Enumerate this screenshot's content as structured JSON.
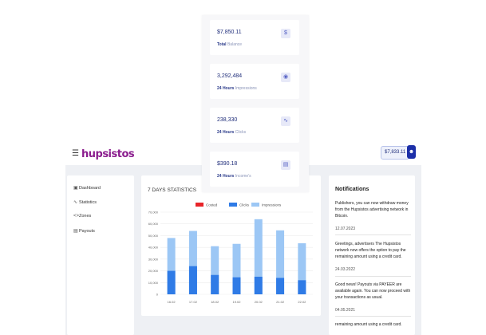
{
  "header": {
    "logo": "hupsistos",
    "balance": "$7,833.11"
  },
  "sidebar": {
    "items": [
      {
        "label": "Dashboard",
        "icon": "dashboard-icon"
      },
      {
        "label": "Statistics",
        "icon": "statistics-icon"
      },
      {
        "label": "Zones",
        "icon": "code-icon"
      },
      {
        "label": "Payouts",
        "icon": "document-icon"
      }
    ]
  },
  "stats_cards": [
    {
      "value": "$7,850.11",
      "label_bold": "Total",
      "label_rest": "Balance",
      "icon": "dollar-icon"
    },
    {
      "value": "3,292,484",
      "label_bold": "24 Hours",
      "label_rest": "Impressions",
      "icon": "eye-icon"
    },
    {
      "value": "238,330",
      "label_bold": "24 Hours",
      "label_rest": "Clicks",
      "icon": "activity-icon"
    },
    {
      "value": "$390.18",
      "label_bold": "24 Hours",
      "label_rest": "Income's",
      "icon": "wallet-icon"
    }
  ],
  "chart_panel": {
    "title": "7 DAYS STATISTICS"
  },
  "chart_data": {
    "type": "bar",
    "categories": [
      "16.02",
      "17.02",
      "18.02",
      "19.02",
      "20.02",
      "21.02",
      "22.02"
    ],
    "series": [
      {
        "name": "Costed",
        "values": [
          0,
          0,
          0,
          0,
          0,
          0,
          0
        ],
        "color": "#e8252a"
      },
      {
        "name": "Clicks",
        "values": [
          20000,
          24000,
          16500,
          14500,
          15000,
          14000,
          12000
        ],
        "color": "#2f7be6"
      },
      {
        "name": "Impressions",
        "values": [
          48000,
          54000,
          41000,
          43000,
          64000,
          54500,
          43500
        ],
        "color": "#9cc7f5"
      }
    ],
    "stacked": false,
    "ylim": [
      0,
      70000
    ],
    "yticks": [
      "70,000",
      "60,000",
      "50,000",
      "40,000",
      "30,000",
      "20,000",
      "10,000",
      "0"
    ],
    "legend_position": "top-center",
    "grid": true
  },
  "notifications": {
    "title": "Notifications",
    "items": [
      {
        "text": "Publishers, you can now withdraw money from the Hupsistos advertising network in Bitcoin.",
        "date": "12.07.2023"
      },
      {
        "text": "Greetings, advertisers The Hupsistos network now offers the option to pay the remaining amount using a credit card.",
        "date": "24.03.2022"
      },
      {
        "text": "Good news! Payouts via PAYEER are available again. You can now proceed with your transactions as usual.",
        "date": "04.05.2021"
      },
      {
        "text": "remaining amount using a credit card.",
        "date": ""
      }
    ]
  }
}
